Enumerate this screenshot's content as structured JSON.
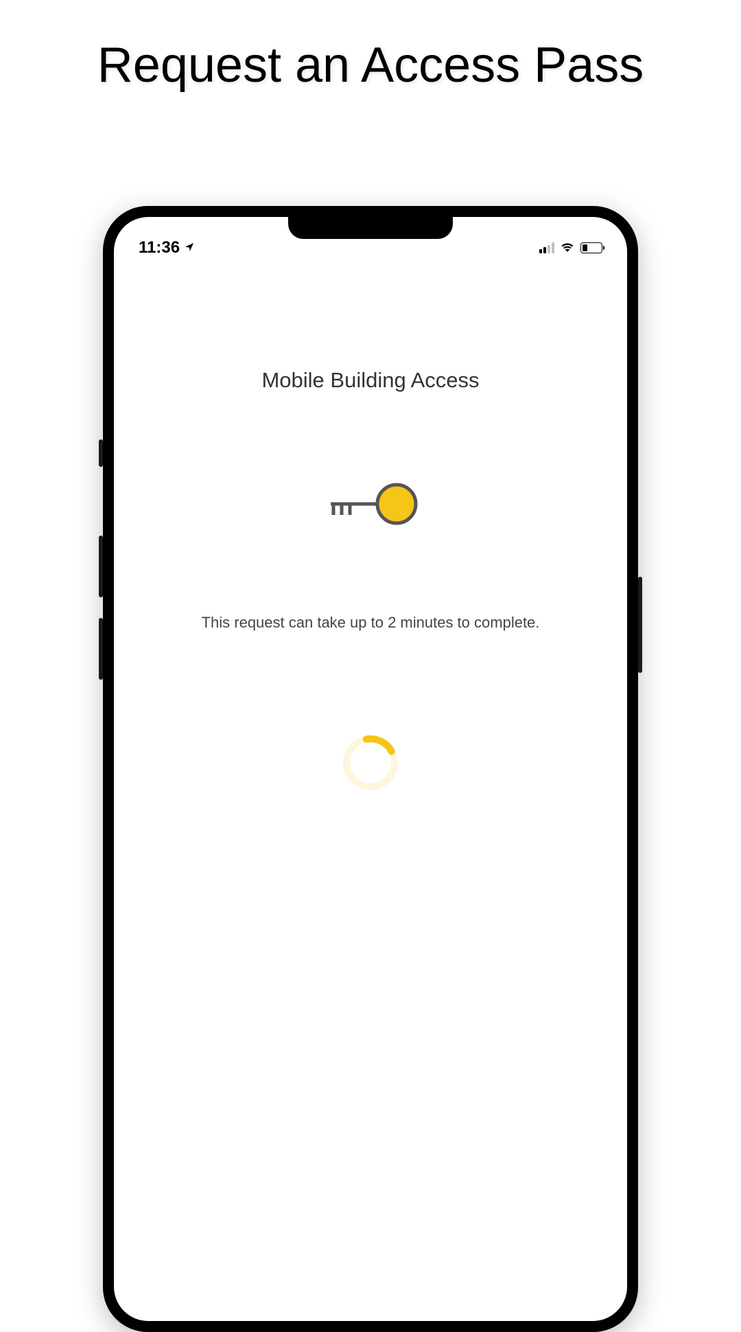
{
  "marketing": {
    "title": "Request an Access Pass"
  },
  "statusBar": {
    "time": "11:36"
  },
  "screen": {
    "title": "Mobile Building Access",
    "message": "This request can take up to 2 minutes to complete."
  },
  "colors": {
    "accent": "#F5C518",
    "spinner": "#F5C518"
  }
}
